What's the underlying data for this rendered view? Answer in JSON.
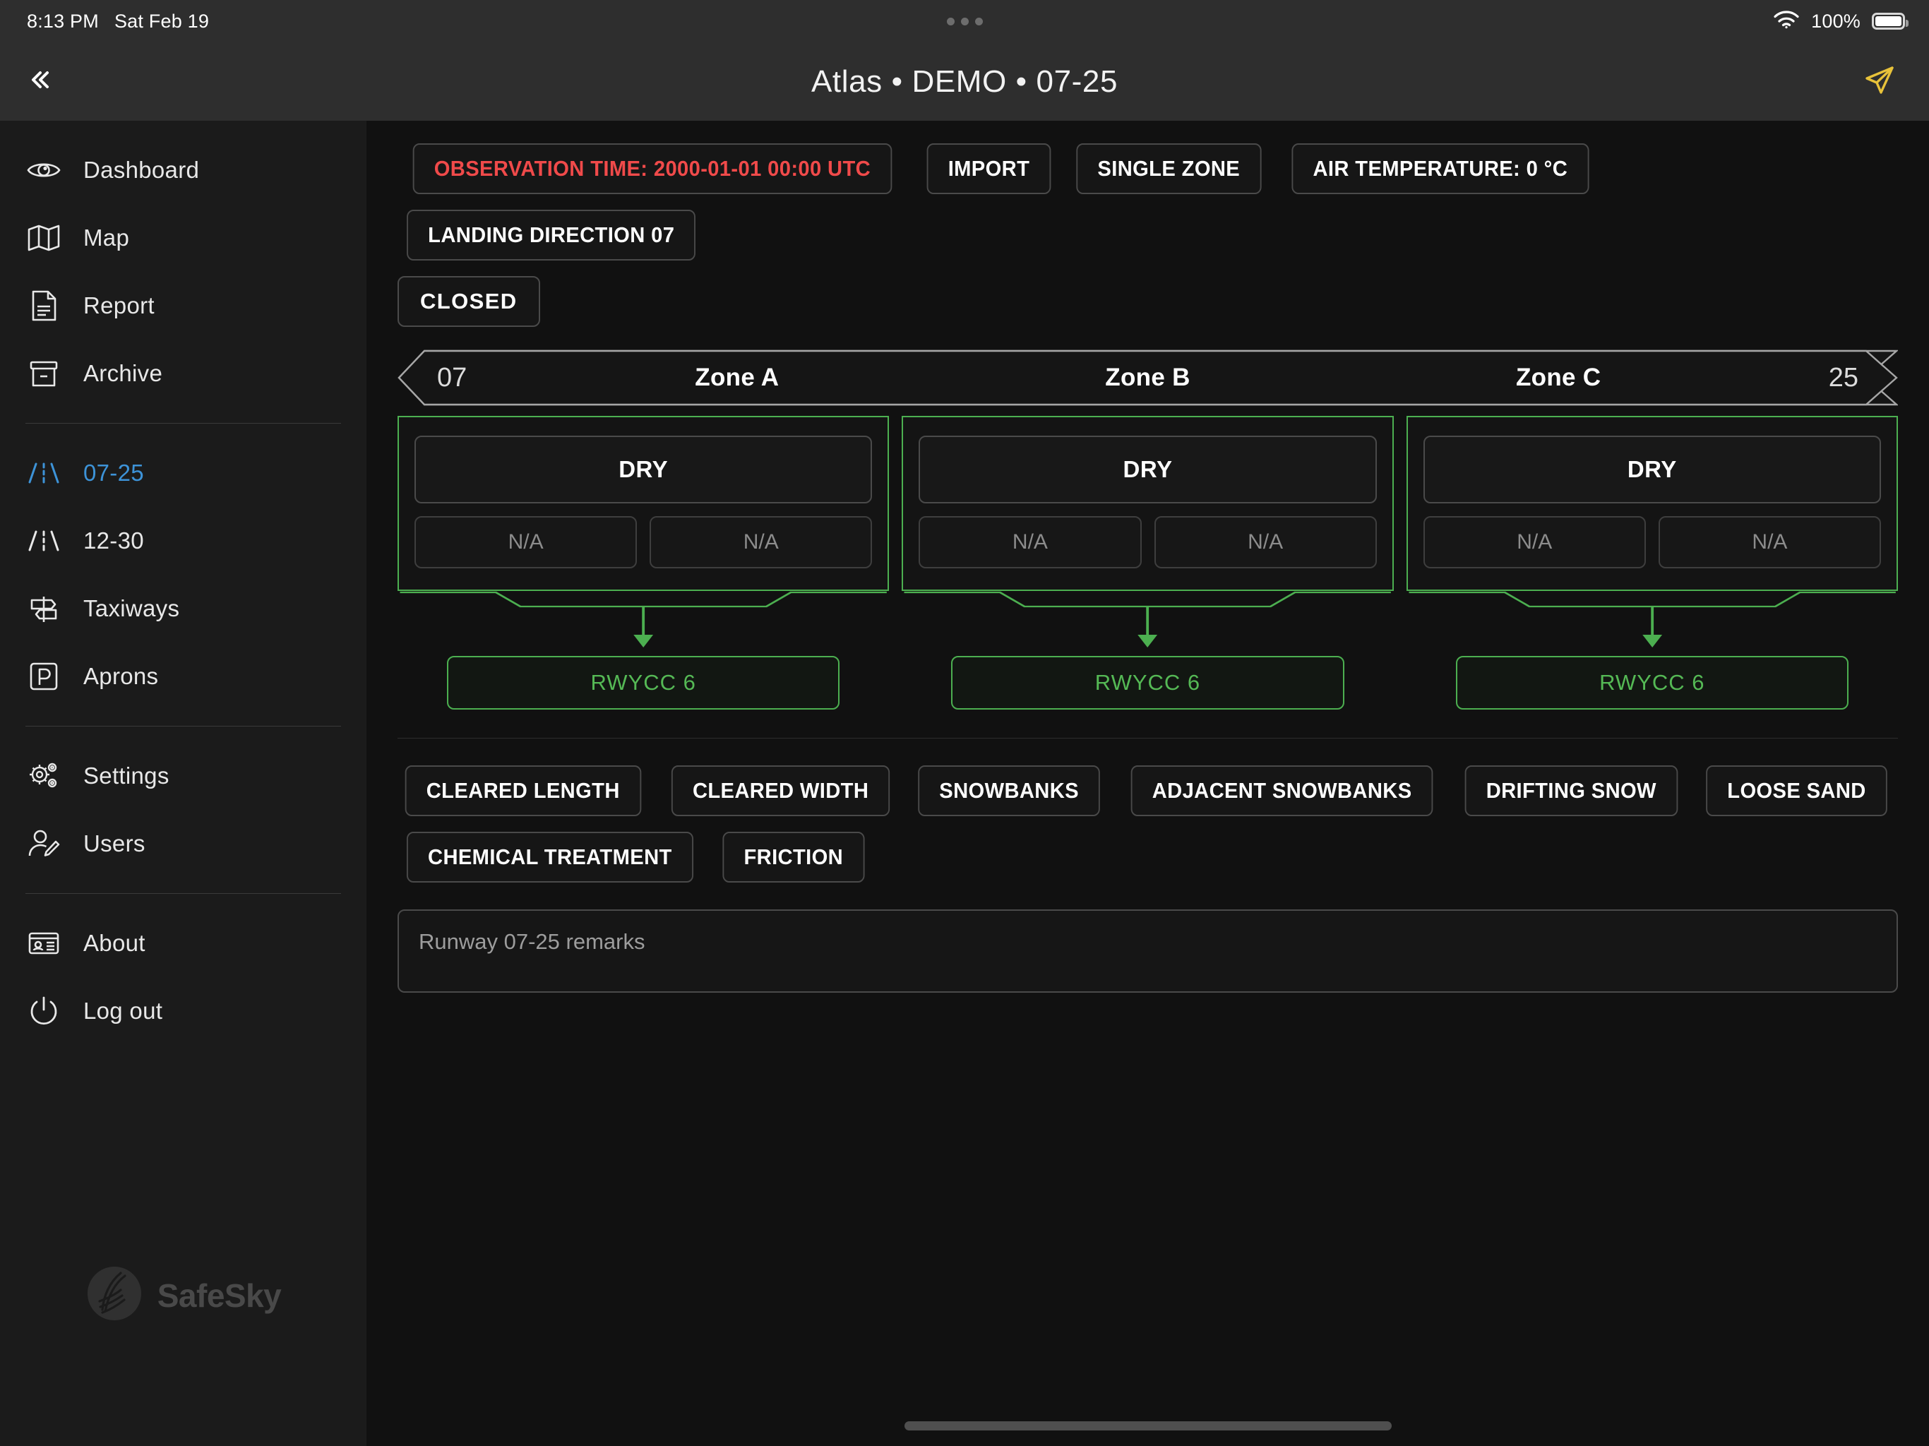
{
  "status_bar": {
    "time": "8:13 PM",
    "date": "Sat Feb 19",
    "battery_percent": "100%",
    "wifi_icon": "wifi-icon",
    "battery_icon": "battery-full-icon",
    "multitask_dots": "multitask-handle-icon"
  },
  "titlebar": {
    "collapse_icon": "double-chevron-left-icon",
    "title": "Atlas • DEMO • 07-25",
    "send_icon": "paper-plane-icon"
  },
  "sidebar": {
    "items": [
      {
        "label": "Dashboard",
        "icon": "eye-icon",
        "active": false
      },
      {
        "label": "Map",
        "icon": "map-icon",
        "active": false
      },
      {
        "label": "Report",
        "icon": "document-icon",
        "active": false
      },
      {
        "label": "Archive",
        "icon": "archive-box-icon",
        "active": false
      },
      {
        "label": "07-25",
        "icon": "runway-icon",
        "active": true
      },
      {
        "label": "12-30",
        "icon": "runway-icon",
        "active": false
      },
      {
        "label": "Taxiways",
        "icon": "signpost-icon",
        "active": false
      },
      {
        "label": "Aprons",
        "icon": "parking-icon",
        "active": false
      },
      {
        "label": "Settings",
        "icon": "gears-icon",
        "active": false
      },
      {
        "label": "Users",
        "icon": "user-edit-icon",
        "active": false
      },
      {
        "label": "About",
        "icon": "id-card-icon",
        "active": false
      },
      {
        "label": "Log out",
        "icon": "power-icon",
        "active": false
      }
    ],
    "brand_name": "SafeSky",
    "brand_icon": "safesky-logo-icon"
  },
  "toolbar": {
    "observation_time": "OBSERVATION TIME: 2000-01-01 00:00 UTC",
    "import": "IMPORT",
    "single_zone": "SINGLE ZONE",
    "air_temperature": "AIR TEMPERATURE: 0 °C",
    "landing_direction": "LANDING DIRECTION 07",
    "closed": "CLOSED",
    "alert_color": "#f04a4a"
  },
  "runway": {
    "threshold_left": "07",
    "threshold_right": "25",
    "ok_color": "#4caf50",
    "zones": [
      {
        "name": "Zone A",
        "condition": "DRY",
        "depth_left": "N/A",
        "depth_right": "N/A",
        "rwycc": "RWYCC 6"
      },
      {
        "name": "Zone B",
        "condition": "DRY",
        "depth_left": "N/A",
        "depth_right": "N/A",
        "rwycc": "RWYCC 6"
      },
      {
        "name": "Zone C",
        "condition": "DRY",
        "depth_left": "N/A",
        "depth_right": "N/A",
        "rwycc": "RWYCC 6"
      }
    ]
  },
  "attributes": {
    "row1": [
      "CLEARED LENGTH",
      "CLEARED WIDTH",
      "SNOWBANKS",
      "ADJACENT SNOWBANKS",
      "DRIFTING SNOW",
      "LOOSE SAND"
    ],
    "row2": [
      "CHEMICAL TREATMENT",
      "FRICTION"
    ]
  },
  "remarks": {
    "placeholder": "Runway 07-25 remarks",
    "value": ""
  }
}
